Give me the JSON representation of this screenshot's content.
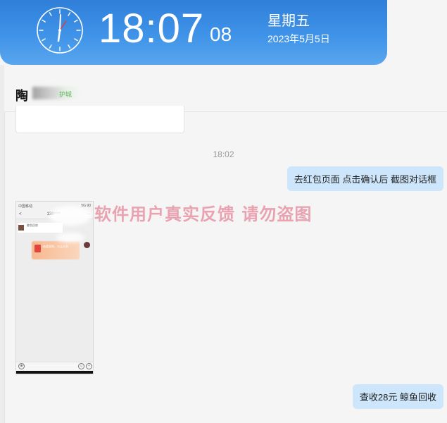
{
  "clock": {
    "time_hm": "18:07",
    "seconds": "08",
    "weekday": "星期五",
    "date": "2023年5月5日"
  },
  "chat": {
    "title": "陶",
    "title_tag": "护城",
    "previous_card": "",
    "timestamp": "18:02",
    "messages": [
      {
        "side": "right",
        "text": "去红包页面  点击确认后  截图对话框"
      },
      {
        "side": "left",
        "type": "image",
        "text": ""
      },
      {
        "side": "right",
        "text": "查收28元    鲸鱼回收"
      }
    ]
  },
  "phone_screenshot": {
    "status_left": "中国移动",
    "status_right": "5G 90",
    "nav_back": "<",
    "nav_title": "138****",
    "nav_more": "···",
    "msg_preview": "鲸鱼回收",
    "red_packet_text": "恭喜发财，大吉大利"
  },
  "watermark": "软件用户真实反馈  请勿盗图",
  "colors": {
    "banner_top": "#2f7fd9",
    "banner_bottom": "#5aa6ee",
    "bubble_right": "#cde6fb",
    "watermark": "#e9a2b0",
    "background": "#f5f5f5"
  }
}
